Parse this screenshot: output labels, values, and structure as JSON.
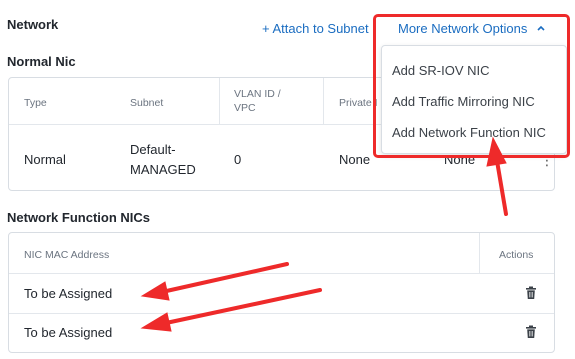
{
  "network": {
    "title": "Network",
    "attach_subnet_label": "+ Attach to Subnet",
    "more_options_label": "More Network Options"
  },
  "dropdown": {
    "items": [
      "Add SR-IOV NIC",
      "Add Traffic Mirroring NIC",
      "Add Network Function NIC"
    ]
  },
  "normal_nic": {
    "title": "Normal Nic",
    "headers": [
      "Type",
      "Subnet",
      "VLAN ID /\nVPC",
      "Private I"
    ],
    "row": {
      "type": "Normal",
      "subnet": "Default-\nMANAGED",
      "vlan": "0",
      "private": "None",
      "extra": "None"
    }
  },
  "nf_nics": {
    "title": "Network Function NICs",
    "headers": [
      "NIC MAC Address",
      "Actions"
    ],
    "rows": [
      {
        "mac": "To be Assigned"
      },
      {
        "mac": "To be Assigned"
      }
    ]
  },
  "annotation": {
    "color": "#ee2a2a"
  }
}
